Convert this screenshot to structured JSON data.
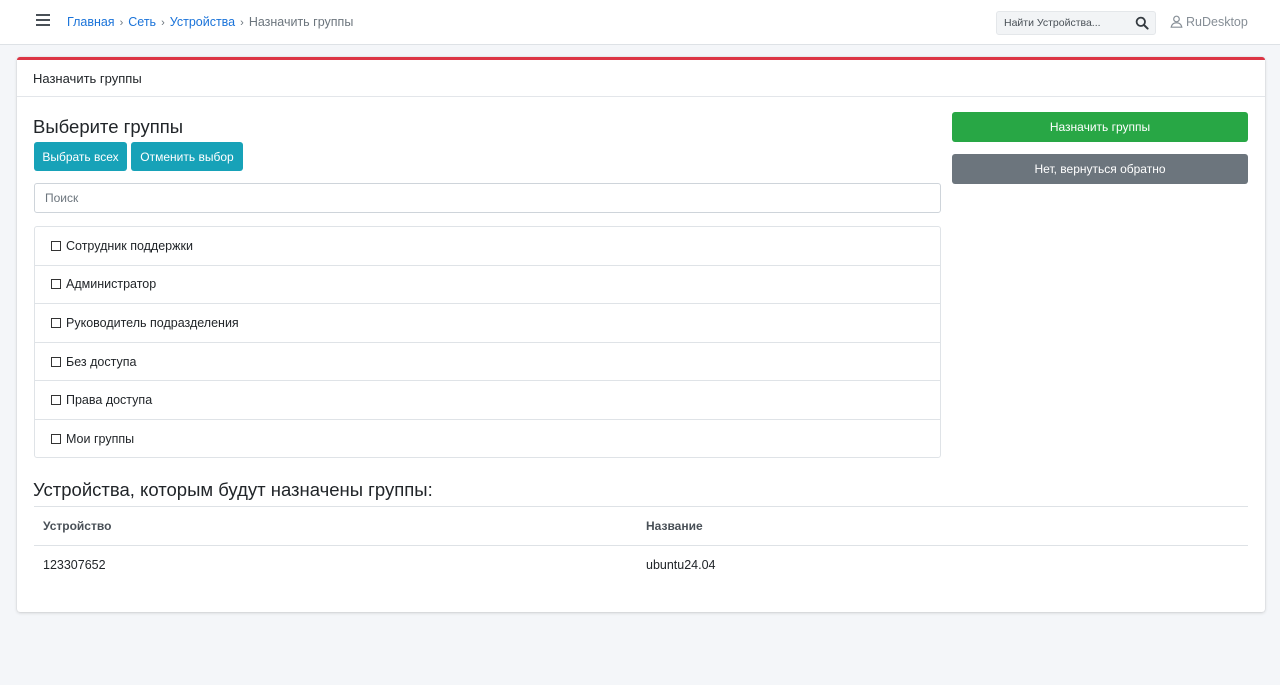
{
  "breadcrumb": {
    "home": "Главная",
    "network": "Сеть",
    "devices": "Устройства",
    "current": "Назначить группы"
  },
  "header": {
    "search_placeholder": "Найти Устройства...",
    "user_name": "RuDesktop",
    "icons": [
      "menu-icon",
      "search-icon",
      "user-icon"
    ]
  },
  "card": {
    "title": "Назначить группы",
    "accent_color": "#dc3545"
  },
  "groups_section": {
    "heading": "Выберите группы",
    "select_all_label": "Выбрать всех",
    "deselect_label": "Отменить выбор",
    "filter_placeholder": "Поиск",
    "items": [
      {
        "label": "Сотрудник поддержки",
        "checked": false
      },
      {
        "label": "Администратор",
        "checked": false
      },
      {
        "label": "Руководитель подразделения",
        "checked": false
      },
      {
        "label": "Без доступа",
        "checked": false
      },
      {
        "label": "Права доступа",
        "checked": false
      },
      {
        "label": "Мои группы",
        "checked": false
      }
    ]
  },
  "actions": {
    "assign_label": "Назначить группы",
    "back_label": "Нет, вернуться обратно",
    "assign_color": "#28a745",
    "back_color": "#6c757d"
  },
  "devices_section": {
    "heading": "Устройства, которым будут назначены группы:",
    "columns": [
      "Устройство",
      "Название"
    ],
    "rows": [
      [
        "123307652",
        "ubuntu24.04"
      ]
    ]
  }
}
